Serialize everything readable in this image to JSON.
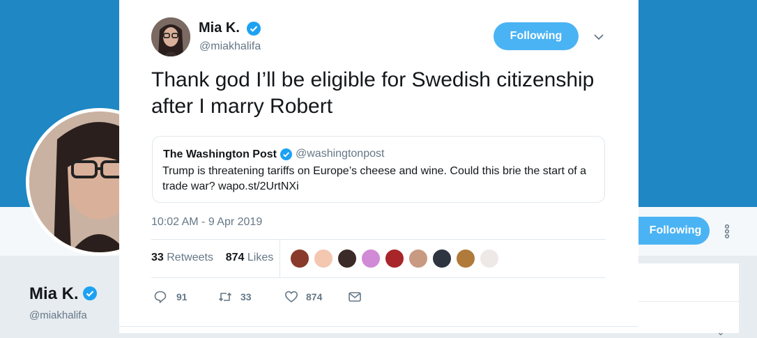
{
  "background": {
    "banner_color": "#1e87c4",
    "profile": {
      "name": "Mia K.",
      "handle": "@miakhalifa",
      "follow_label": "Following"
    }
  },
  "tweet": {
    "author": {
      "name": "Mia K.",
      "handle": "@miakhalifa",
      "verified": true
    },
    "follow_label": "Following",
    "text": "Thank god I’ll be eligible for Swedish citizenship after I marry Robert",
    "quoted": {
      "name": "The Washington Post",
      "handle": "@washingtonpost",
      "verified": true,
      "text": "Trump is threatening tariffs on Europe’s cheese and wine. Could this brie the start of a trade war? wapo.st/2UrtNXi"
    },
    "timestamp": "10:02 AM - 9 Apr 2019",
    "stats": {
      "retweets_count": "33",
      "retweets_label": "Retweets",
      "likes_count": "874",
      "likes_label": "Likes"
    },
    "actions": {
      "reply_count": "91",
      "retweet_count": "33",
      "like_count": "874"
    },
    "accent_color": "#4ab3f4",
    "verified_color": "#1da1f2"
  }
}
